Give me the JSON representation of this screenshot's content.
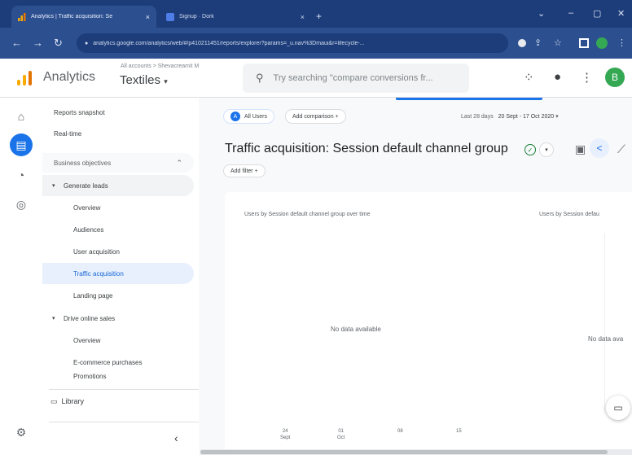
{
  "browser": {
    "tabs": [
      {
        "title": "Analytics | Traffic acquisition: Se",
        "active": true
      },
      {
        "title": "Signup · Dork",
        "active": false
      }
    ],
    "url": "analytics.google.com/analytics/web/#/p410211451/reports/explorer?params=_u.nav%3Dmaui&r=lifecycle-...",
    "new_tab": "+",
    "close": "×"
  },
  "header": {
    "brand": "Analytics",
    "breadcrumb": "All accounts > Shevacreamit M",
    "property": "Textiles",
    "search_placeholder": "Try searching \"compare conversions fr...",
    "avatar_letter": "B",
    "accent": "#1a73e8"
  },
  "nav": {
    "top_items": [
      "Reports snapshot",
      "Real-time"
    ],
    "collection": "Business objectives",
    "sections": [
      {
        "label": "Generate leads",
        "expanded": true,
        "items": [
          "Overview",
          "Audiences",
          "User acquisition",
          "Traffic acquisition",
          "Landing page"
        ]
      },
      {
        "label": "Drive online sales",
        "expanded": true,
        "items": [
          "Overview",
          "E-commerce purchases",
          "Promotions"
        ]
      }
    ],
    "active_item": "Traffic acquisition",
    "library": "Library"
  },
  "main": {
    "segment_chip": "All Users",
    "comparison_chip": "Add comparison +",
    "date_label": "Last 28 days",
    "date_range": "20 Sept - 17 Oct 2020",
    "title": "Traffic acquisition: Session default channel group",
    "filter_chip": "Add filter +",
    "chart_left_title": "Users by Session default channel group over time",
    "chart_right_title": "Users by Session defau",
    "no_data_left": "No data available",
    "no_data_right": "No data ava",
    "x_ticks": [
      {
        "day": "24",
        "month": "Sept"
      },
      {
        "day": "01",
        "month": "Oct"
      },
      {
        "day": "08",
        "month": ""
      },
      {
        "day": "15",
        "month": ""
      }
    ]
  }
}
